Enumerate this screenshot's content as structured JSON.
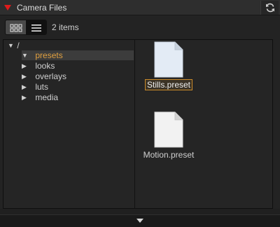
{
  "panel": {
    "title": "Camera Files",
    "accent_color": "#e01b1b",
    "selection_color": "#c98a2a"
  },
  "toolbar": {
    "item_count": "2 items",
    "active_view": "grid"
  },
  "tree": {
    "root": "/",
    "items": [
      {
        "label": "presets",
        "selected": true,
        "expanded": true
      },
      {
        "label": "looks",
        "selected": false,
        "expanded": false
      },
      {
        "label": "overlays",
        "selected": false,
        "expanded": false
      },
      {
        "label": "luts",
        "selected": false,
        "expanded": false
      },
      {
        "label": "media",
        "selected": false,
        "expanded": false
      }
    ]
  },
  "files": [
    {
      "name": "Stills.preset",
      "selected": true
    },
    {
      "name": "Motion.preset",
      "selected": false
    }
  ],
  "icons": {
    "collapse": "collapse-arrow-icon",
    "refresh": "refresh-icon",
    "grid_view": "grid-view-icon",
    "list_view": "list-view-icon",
    "file": "document-icon",
    "expand": "expand-arrow-icon"
  }
}
